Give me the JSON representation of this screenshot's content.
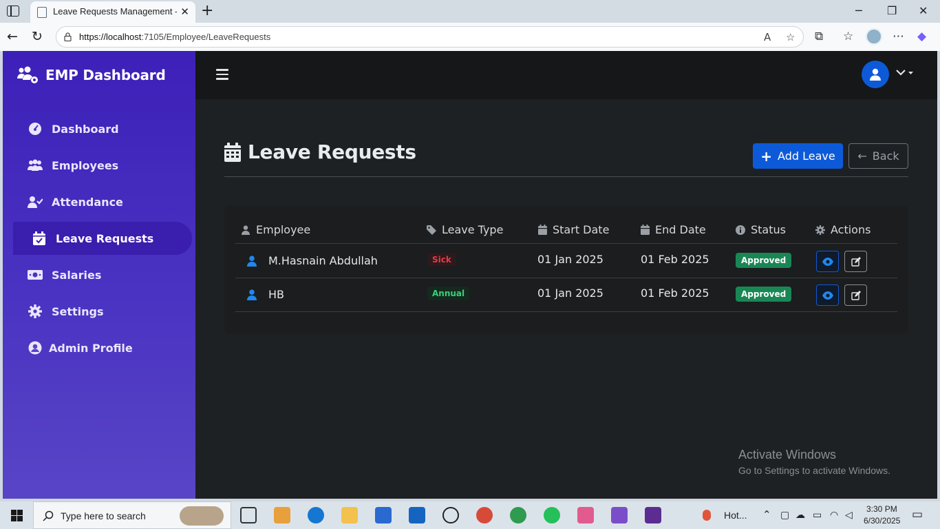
{
  "browser": {
    "tab_title": "Leave Requests Management - Em",
    "url_host": "https://localhost",
    "url_rest": ":7105/Employee/LeaveRequests"
  },
  "brand": "EMP Dashboard",
  "sidebar": {
    "items": [
      {
        "label": "Dashboard",
        "icon": "gauge-icon"
      },
      {
        "label": "Employees",
        "icon": "users-icon"
      },
      {
        "label": "Attendance",
        "icon": "user-check-icon"
      },
      {
        "label": "Leave Requests",
        "icon": "calendar-check-icon",
        "active": true
      },
      {
        "label": "Salaries",
        "icon": "money-icon"
      },
      {
        "label": "Settings",
        "icon": "gear-icon"
      },
      {
        "label": "Admin Profile",
        "icon": "user-circle-icon"
      }
    ]
  },
  "page": {
    "title": "Leave Requests",
    "add_label": "Add Leave",
    "back_label": "Back"
  },
  "table": {
    "headers": [
      "Employee",
      "Leave Type",
      "Start Date",
      "End Date",
      "Status",
      "Actions"
    ],
    "rows": [
      {
        "employee": "M.Hasnain Abdullah",
        "leave_type": "Sick",
        "start": "01 Jan 2025",
        "end": "01 Feb 2025",
        "status": "Approved"
      },
      {
        "employee": "HB",
        "leave_type": "Annual",
        "start": "01 Jan 2025",
        "end": "01 Feb 2025",
        "status": "Approved"
      }
    ]
  },
  "watermark": {
    "line1": "Activate Windows",
    "line2": "Go to Settings to activate Windows."
  },
  "taskbar": {
    "search_placeholder": "Type here to search",
    "weather": "Hot...",
    "time": "3:30 PM",
    "date": "6/30/2025"
  },
  "colors": {
    "sidebar_top": "#3d20b8",
    "sidebar_bottom": "#5845c6",
    "primary": "#0d5ad9",
    "success": "#198754",
    "danger_text": "#e6394a",
    "content_bg": "#1e2123"
  }
}
